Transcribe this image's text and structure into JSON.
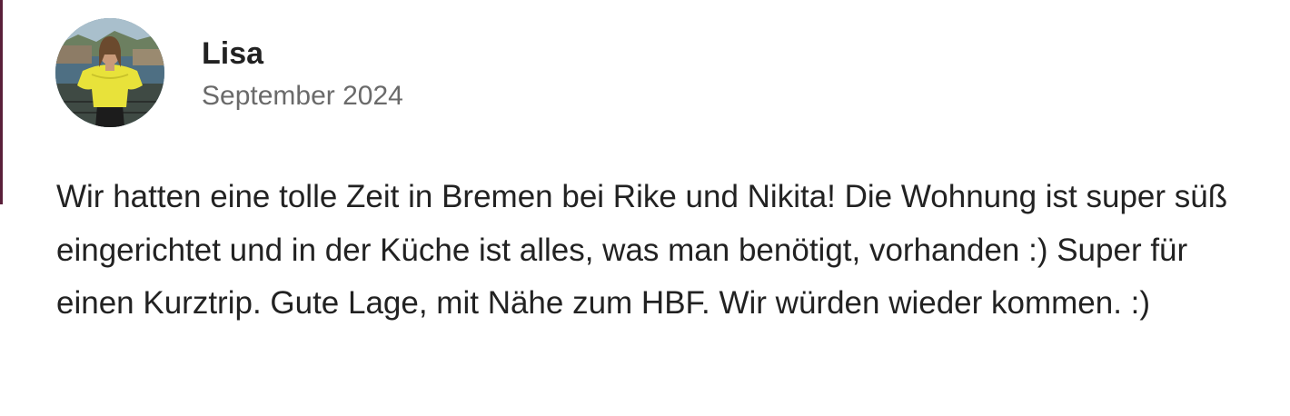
{
  "review": {
    "author": {
      "name": "Lisa",
      "avatar_icon": "user-photo-avatar"
    },
    "date": "September 2024",
    "text": "Wir hatten eine tolle Zeit in Bremen bei Rike und Nikita! Die Wohnung ist super süß eingerichtet und in der Küche ist alles, was man benötigt, vorhanden :) Super für einen Kurztrip. Gute Lage, mit Nähe zum HBF. Wir würden wieder kommen. :)"
  },
  "colors": {
    "text_primary": "#222222",
    "text_secondary": "#6a6a6a",
    "background": "#ffffff",
    "edge_accent": "#5a1f3a"
  }
}
